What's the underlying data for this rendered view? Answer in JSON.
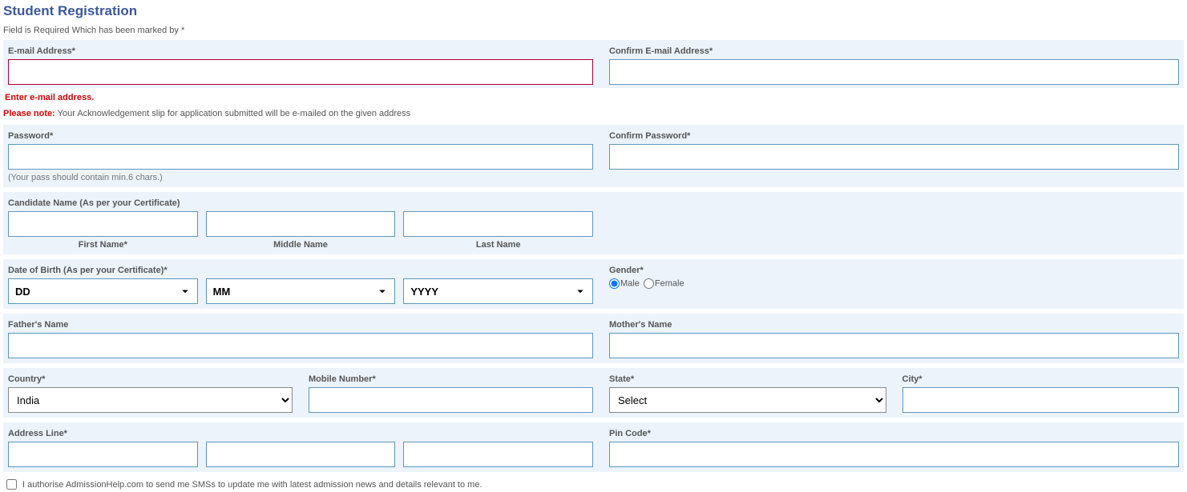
{
  "page_title": "Student Registration",
  "required_note": "Field is Required Which has been marked by *",
  "email": {
    "label": "E-mail Address*",
    "confirm_label": "Confirm E-mail Address*",
    "error": "Enter e-mail address.",
    "please_note_prefix": "Please note:",
    "please_note_text": " Your Acknowledgement slip for application submitted will be e-mailed on the given address"
  },
  "password": {
    "label": "Password*",
    "confirm_label": "Confirm Password*",
    "hint": "(Your pass should contain min.6 chars.)"
  },
  "name": {
    "section_label": "Candidate Name (As per your Certificate)",
    "first": "First Name*",
    "middle": "Middle Name",
    "last": "Last Name"
  },
  "dob": {
    "label": "Date of Birth (As per your Certificate)*",
    "dd": "DD",
    "mm": "MM",
    "yyyy": "YYYY"
  },
  "gender": {
    "label": "Gender*",
    "male": "Male",
    "female": "Female"
  },
  "parents": {
    "father": "Father's Name",
    "mother": "Mother's Name"
  },
  "location": {
    "country_label": "Country*",
    "country_value": "India",
    "mobile_label": "Mobile Number*",
    "state_label": "State*",
    "state_value": "Select",
    "city_label": "City*"
  },
  "address": {
    "label": "Address Line*",
    "pin_label": "Pin Code*"
  },
  "authorise": "I authorise AdmissionHelp.com to send me SMSs to update me with latest admission news and details relevant to me."
}
